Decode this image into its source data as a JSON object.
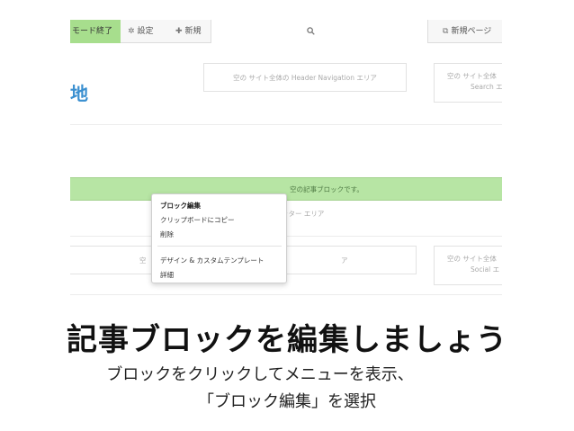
{
  "toolbar": {
    "edit_mode_end": "モード終了",
    "settings_icon": "gear-icon",
    "settings_label": "設定",
    "new_icon": "plus-icon",
    "new_label": "新規",
    "search_icon": "search-icon",
    "new_page_icon": "page-copy-icon",
    "new_page_label": "新規ページ"
  },
  "header": {
    "site_title": "地",
    "header_nav_area": "空の サイト全体の Header Navigation エリア",
    "search_area_line1": "空の サイト全体",
    "search_area_line2": "Search エ"
  },
  "main": {
    "article_block": "空の記事ブロックです。",
    "footer_area": "ッター エリア",
    "bottom_left_area": "空",
    "bottom_left_area_tail": "ア",
    "social_area_line1": "空の サイト全体",
    "social_area_line2": "Social エ"
  },
  "context_menu": {
    "items": [
      "ブロック編集",
      "クリップボードにコピー",
      "削除",
      "デザイン & カスタムテンプレート",
      "詳細"
    ]
  },
  "caption": {
    "title": "記事ブロックを編集しましょう",
    "line1": "ブロックをクリックしてメニューを表示、",
    "line2": "「ブロック編集」を選択"
  },
  "colors": {
    "edit_mode_green": "#a7de8d",
    "article_bar_green": "#b7e5a4",
    "site_title_blue": "#3a8fd0"
  }
}
